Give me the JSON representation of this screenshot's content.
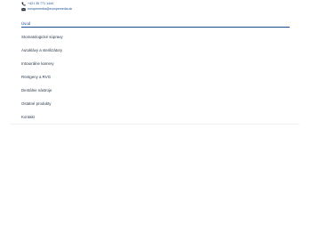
{
  "contact": {
    "phone": "+421 35 771 1444",
    "email": "europemedia@europemedia.sk",
    "phone_icon": "phone-icon",
    "email_icon": "envelope-icon",
    "accent_color": "#1a4d8f"
  },
  "nav": {
    "items": [
      {
        "label": "Úvod",
        "active": true
      },
      {
        "label": "Stomatologické súpravy",
        "active": false
      },
      {
        "label": "Autoklávy a sterilizátory",
        "active": false
      },
      {
        "label": "Intraorálne kamery",
        "active": false
      },
      {
        "label": "Röntgeny a RVG",
        "active": false
      },
      {
        "label": "Dentálne nástroje",
        "active": false
      },
      {
        "label": "Ostatné produkty",
        "active": false
      },
      {
        "label": "Kontakt",
        "active": false
      }
    ]
  }
}
